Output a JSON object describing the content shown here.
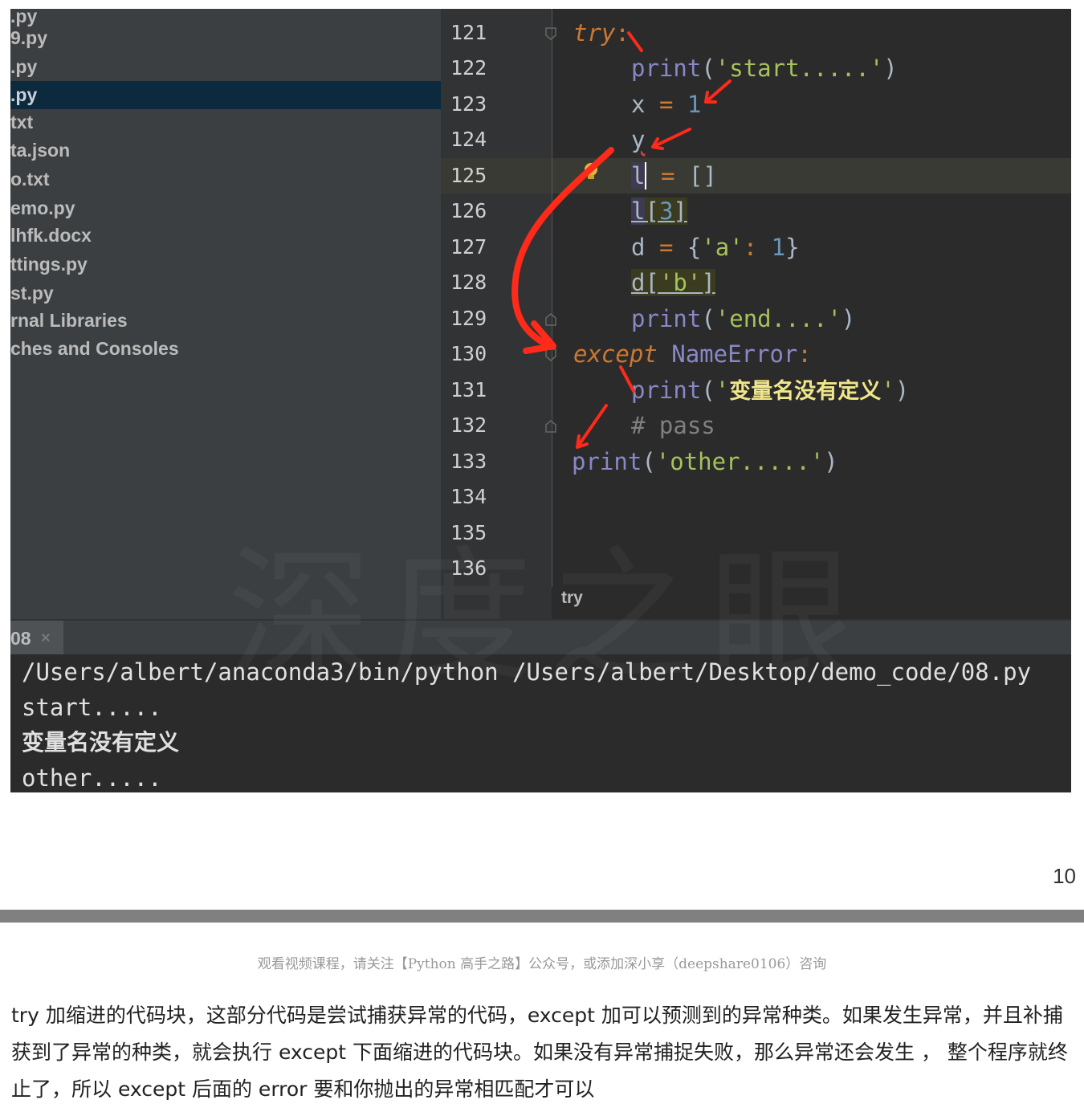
{
  "project_tree": {
    "items": [
      {
        "label": ".py",
        "selected": false
      },
      {
        "label": "9.py",
        "selected": false
      },
      {
        "label": ".py",
        "selected": false
      },
      {
        "label": ".py",
        "selected": true
      },
      {
        "label": "txt",
        "selected": false
      },
      {
        "label": "ta.json",
        "selected": false
      },
      {
        "label": "o.txt",
        "selected": false
      },
      {
        "label": "emo.py",
        "selected": false
      },
      {
        "label": "lhfk.docx",
        "selected": false
      },
      {
        "label": "ttings.py",
        "selected": false
      },
      {
        "label": "st.py",
        "selected": false
      },
      {
        "label": "rnal Libraries",
        "selected": false
      },
      {
        "label": "ches and Consoles",
        "selected": false
      }
    ]
  },
  "editor": {
    "line_numbers": [
      "121",
      "122",
      "123",
      "124",
      "125",
      "126",
      "127",
      "128",
      "129",
      "130",
      "131",
      "132",
      "133",
      "134",
      "135",
      "136"
    ],
    "breadcrumb": "try",
    "lines": {
      "l121": {
        "kw": "try",
        "colon": ":"
      },
      "l122": {
        "fn": "print",
        "open": "(",
        "str": "'start.....'",
        "close": ")"
      },
      "l123": {
        "var": "x",
        "op": "=",
        "num": "1"
      },
      "l124": {
        "var": "y"
      },
      "l125": {
        "var": "l",
        "op": "=",
        "val": "[]"
      },
      "l126": {
        "var": "l",
        "open": "[",
        "num": "3",
        "close": "]"
      },
      "l127": {
        "var": "d",
        "op": "=",
        "open": "{",
        "key": "'a'",
        "colon": ":",
        "num": "1",
        "close": "}"
      },
      "l128": {
        "var": "d",
        "open": "[",
        "key": "'b'",
        "close": "]"
      },
      "l129": {
        "fn": "print",
        "open": "(",
        "str": "'end....'",
        "close": ")"
      },
      "l130": {
        "kw": "except",
        "name": "NameError",
        "colon": ":"
      },
      "l131": {
        "fn": "print",
        "open": "(",
        "q1": "'",
        "cn": "变量名没有定义",
        "q2": "'",
        "close": ")"
      },
      "l132": {
        "comment": "# pass"
      },
      "l133": {
        "fn": "print",
        "open": "(",
        "str": "'other.....'",
        "close": ")"
      }
    }
  },
  "run": {
    "tab_label": "08",
    "tab_close": "×",
    "console_lines": [
      "/Users/albert/anaconda3/bin/python /Users/albert/Desktop/demo_code/08.py",
      "start.....",
      "变量名没有定义",
      "other....."
    ]
  },
  "watermark": "深度之眼",
  "page": {
    "number": "10",
    "footer_note": "观看视频课程，请关注【Python 高手之路】公众号，或添加深小享（deepshare0106）咨询",
    "explanation": "try 加缩进的代码块，这部分代码是尝试捕获异常的代码，except 加可以预测到的异常种类。如果发生异常，并且补捕获到了异常的种类，就会执行 except 下面缩进的代码块。如果没有异常捕捉失败，那么异常还会发生 ， 整个程序就终止了，所以 except 后面的 error 要和你抛出的异常相匹配才可以"
  },
  "colors": {
    "keyword": "#cc7832",
    "string": "#a5c25c",
    "number": "#6897bb",
    "builtin": "#8888c6",
    "annotation_arrow": "#ff2a1a",
    "selection": "#0d293e"
  }
}
